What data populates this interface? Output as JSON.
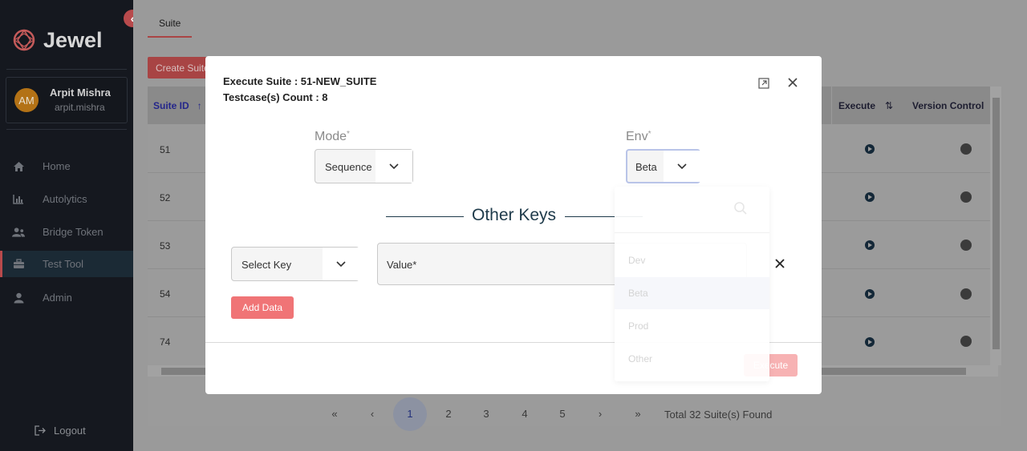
{
  "brand": {
    "name": "Jewel"
  },
  "sidebar": {
    "user": {
      "initials": "AM",
      "name": "Arpit Mishra",
      "handle": "arpit.mishra"
    },
    "items": [
      {
        "label": "Home",
        "icon": "home-icon"
      },
      {
        "label": "Autolytics",
        "icon": "chart-icon"
      },
      {
        "label": "Bridge Token",
        "icon": "users-icon"
      },
      {
        "label": "Test Tool",
        "icon": "toolbox-icon",
        "active": true
      },
      {
        "label": "Admin",
        "icon": "user-icon"
      }
    ],
    "logout": "Logout"
  },
  "main": {
    "tab": "Suite",
    "create_button": "Create Suite",
    "table": {
      "headers": {
        "suite_id": "Suite ID",
        "execute": "Execute",
        "version_control": "Version Control"
      },
      "rows": [
        "51",
        "52",
        "53",
        "54",
        "74"
      ]
    },
    "pagination": {
      "pages": [
        "1",
        "2",
        "3",
        "4",
        "5"
      ],
      "first": "«",
      "prev": "‹",
      "next": "›",
      "last": "»",
      "total": "Total 32 Suite(s) Found",
      "page_size": "5"
    }
  },
  "modal": {
    "title": "Execute Suite : 51-NEW_SUITE",
    "subtitle": "Testcase(s) Count : 8",
    "mode": {
      "label": "Mode",
      "value": "Sequence"
    },
    "env": {
      "label": "Env",
      "value": "Beta",
      "options": [
        "Dev",
        "Beta",
        "Prod",
        "Other"
      ]
    },
    "other_keys_title": "Other Keys",
    "select_key_placeholder": "Select Key",
    "value_placeholder": "Value*",
    "add_data": "Add Data",
    "execute": "Execute"
  },
  "colors": {
    "accent": "#f07476",
    "sidebar_bg": "#15181f",
    "navy": "#1e3a4a"
  }
}
